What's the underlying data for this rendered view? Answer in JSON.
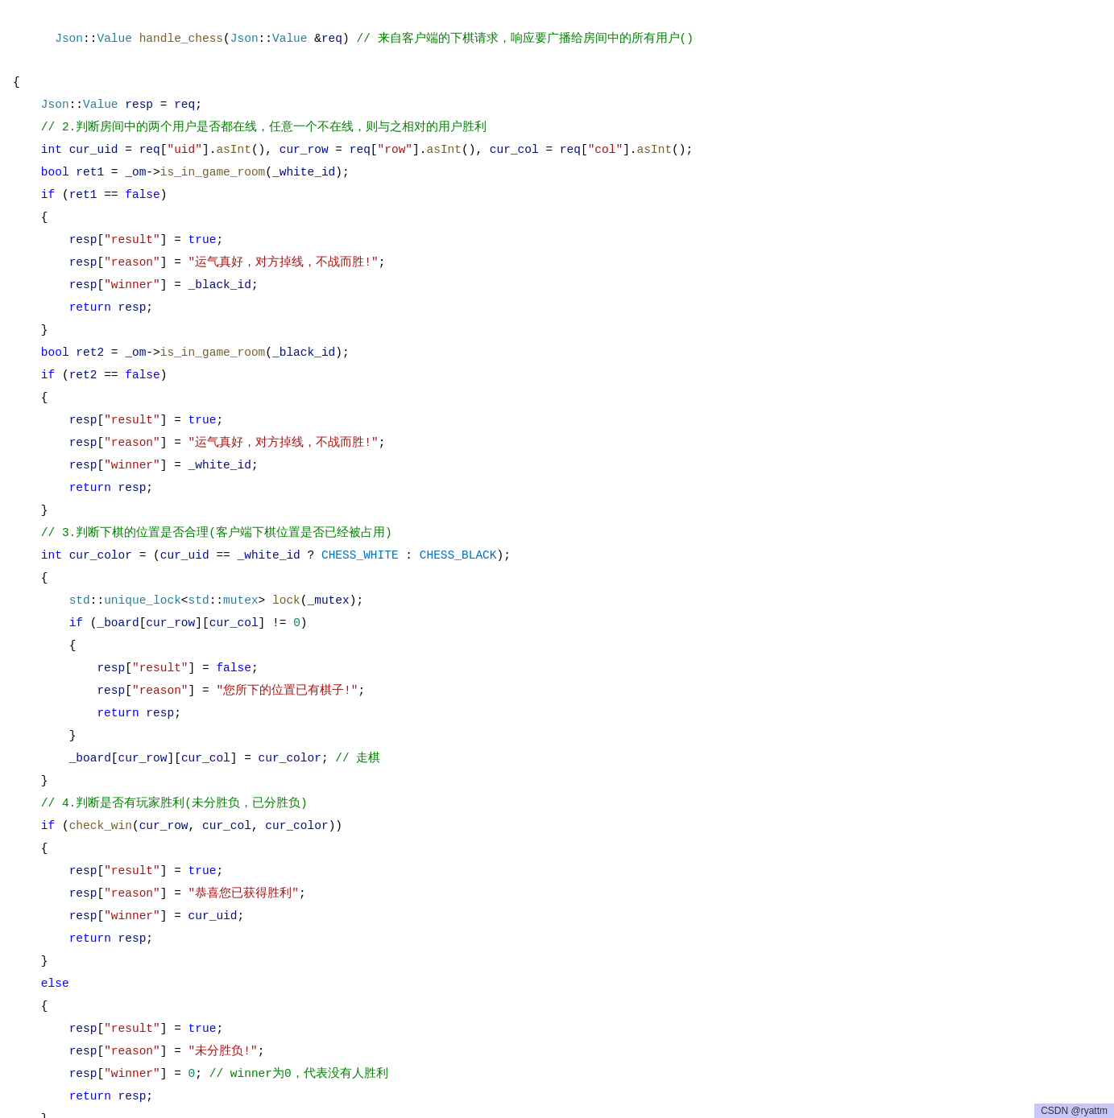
{
  "editor": {
    "background": "#ffffff",
    "lines": []
  },
  "watermark": "CSDN @ryattm"
}
